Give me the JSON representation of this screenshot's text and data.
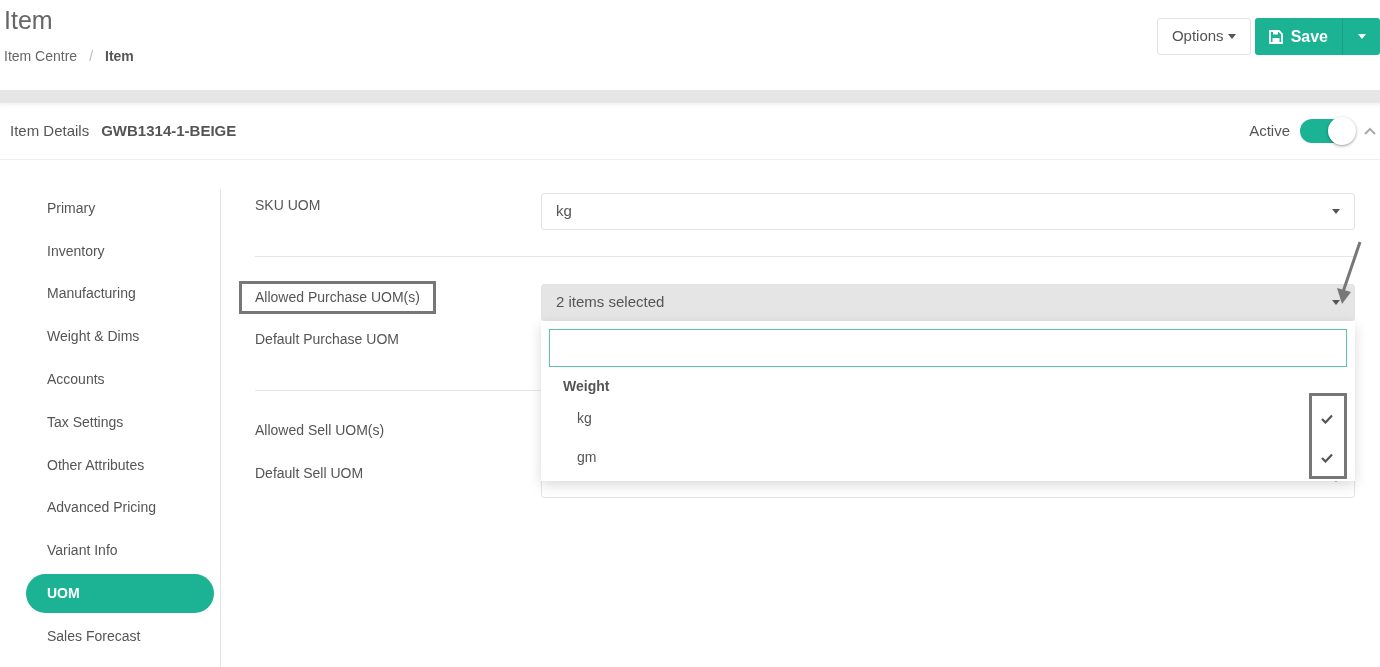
{
  "page": {
    "title": "Item",
    "breadcrumb": [
      {
        "label": "Item Centre",
        "current": false
      },
      {
        "label": "Item",
        "current": true
      }
    ],
    "separator": "/"
  },
  "actions": {
    "options": "Options",
    "save": "Save"
  },
  "details": {
    "label": "Item Details",
    "code": "GWB1314-1-BEIGE",
    "active_label": "Active",
    "active": true
  },
  "sidebar": {
    "items": [
      {
        "label": "Primary",
        "selected": false
      },
      {
        "label": "Inventory",
        "selected": false
      },
      {
        "label": "Manufacturing",
        "selected": false
      },
      {
        "label": "Weight & Dims",
        "selected": false
      },
      {
        "label": "Accounts",
        "selected": false
      },
      {
        "label": "Tax Settings",
        "selected": false
      },
      {
        "label": "Other Attributes",
        "selected": false
      },
      {
        "label": "Advanced Pricing",
        "selected": false
      },
      {
        "label": "Variant Info",
        "selected": false
      },
      {
        "label": "UOM",
        "selected": true
      },
      {
        "label": "Sales Forecast",
        "selected": false
      }
    ]
  },
  "sections": [
    {
      "fields": [
        {
          "label": "SKU UOM",
          "value": "kg",
          "open": false,
          "highlighted": false
        }
      ]
    },
    {
      "fields": [
        {
          "label": "Allowed Purchase UOM(s)",
          "value": "2 items selected",
          "open": true,
          "highlighted": true
        },
        {
          "label": "Default Purchase UOM",
          "open": false,
          "highlighted": false
        }
      ]
    },
    {
      "fields": [
        {
          "label": "Allowed Sell UOM(s)",
          "open": false,
          "highlighted": false
        },
        {
          "label": "Default Sell UOM",
          "open": false,
          "highlighted": false
        }
      ]
    }
  ],
  "dropdown": {
    "group": "Weight",
    "options": [
      {
        "label": "kg",
        "checked": true
      },
      {
        "label": "gm",
        "checked": true
      }
    ],
    "checks_highlighted": true
  }
}
